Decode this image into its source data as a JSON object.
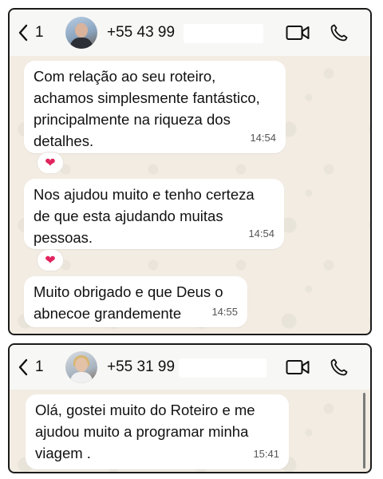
{
  "chat1": {
    "back_count": "1",
    "phone": "+55 43 99",
    "messages": [
      {
        "text": "Com relação ao seu roteiro,\nachamos simplesmente fantástico,\nprincipalmente na riqueza dos\ndetalhes.",
        "time": "14:54",
        "reaction": "❤"
      },
      {
        "text": "Nos ajudou muito e tenho certeza\nde que esta ajudando muitas\npessoas.",
        "time": "14:54",
        "reaction": "❤"
      },
      {
        "text": "Muito obrigado e que Deus o\nabnecoe grandemente",
        "time": "14:55"
      }
    ]
  },
  "chat2": {
    "back_count": "1",
    "phone": "+55 31 99",
    "messages": [
      {
        "text": "Olá, gostei muito do Roteiro e me\najudou muito a programar  minha\nviagem .",
        "time": "15:41"
      }
    ]
  },
  "icons": {
    "back": "chevron-left-icon",
    "video": "video-camera-icon",
    "call": "phone-icon",
    "reaction": "heart-icon"
  },
  "colors": {
    "chat_background": "#f2ece2",
    "bubble": "#ffffff",
    "header": "#f7f7f5",
    "heart": "#e0245e"
  }
}
